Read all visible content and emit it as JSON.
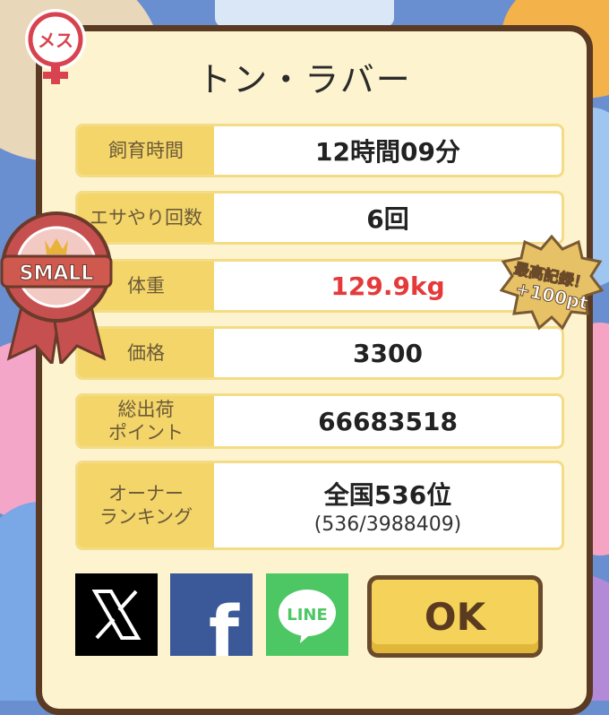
{
  "title": "トン・ラバー",
  "gender_badge": "メス",
  "ribbon_label": "SMALL",
  "record_badge": {
    "line1": "最高記録！",
    "line2": "+100pt"
  },
  "rows": [
    {
      "label": "飼育時間",
      "value": "12時間09分"
    },
    {
      "label": "エサやり回数",
      "value": "6回"
    },
    {
      "label": "体重",
      "value": "129.9kg"
    },
    {
      "label": "価格",
      "value": "3300"
    },
    {
      "label": "総出荷\nポイント",
      "value": "66683518"
    },
    {
      "label": "オーナー\nランキング",
      "value": "全国536位",
      "sub": "(536/3988409)"
    }
  ],
  "social": {
    "x": "X",
    "facebook": "f",
    "line": "LINE"
  },
  "ok_label": "OK",
  "colors": {
    "weight_highlight": "#e53a3a",
    "label_bg": "#f4d56a",
    "panel_bg": "#fdf4cf"
  }
}
